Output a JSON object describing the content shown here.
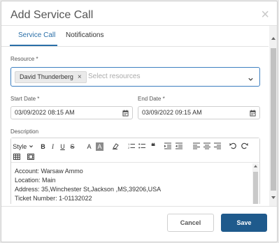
{
  "dialog": {
    "title": "Add Service Call",
    "close_glyph": "×"
  },
  "tabs": [
    {
      "label": "Service Call",
      "active": true
    },
    {
      "label": "Notifications",
      "active": false
    }
  ],
  "resource": {
    "label": "Resource",
    "required_mark": "*",
    "chip": "David Thunderberg",
    "chip_remove": "×",
    "placeholder": "Select resources"
  },
  "start_date": {
    "label": "Start Date",
    "required_mark": "*",
    "value": "03/09/2022 08:15 AM"
  },
  "end_date": {
    "label": "End Date",
    "required_mark": "*",
    "value": "03/09/2022 09:15 AM"
  },
  "description": {
    "label": "Description",
    "toolbar": {
      "style": "Style",
      "bold": "B",
      "italic": "I",
      "underline": "U",
      "strike": "S",
      "font_color": "A",
      "bg_color": "A"
    },
    "lines": [
      "Account: Warsaw Ammo",
      "Location: Main",
      "Address: 35,Winchester St,Jackson ,MS,39206,USA",
      "Ticket Number: 1-01132022"
    ]
  },
  "buttons": {
    "cancel": "Cancel",
    "save": "Save"
  },
  "colors": {
    "accent": "#2a6fa8",
    "save_button": "#1f5a8c",
    "focus_border": "#3d7fc0"
  }
}
